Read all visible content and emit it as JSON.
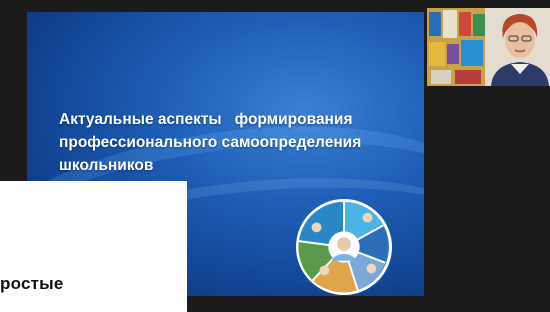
{
  "slide": {
    "title_line1": "Актуальные аспекты   формирования",
    "title_line2": "профессионального самоопределения",
    "title_line3": "школьников",
    "colors": {
      "background": "#1f5fb8",
      "title": "#ffffff"
    }
  },
  "webcam": {
    "icon": "person-video-icon"
  },
  "popup": {
    "text": "ростые"
  }
}
